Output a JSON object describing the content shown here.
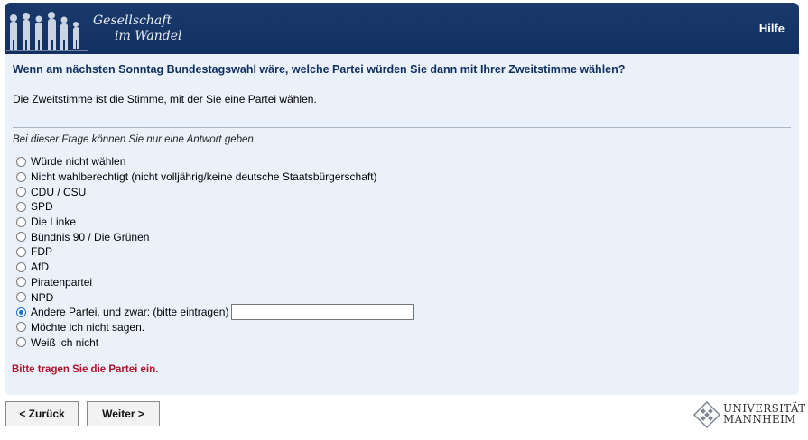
{
  "header": {
    "logo_line1": "Gesellschaft",
    "logo_line2": "im Wandel",
    "help_label": "Hilfe",
    "background_color": "#163567"
  },
  "question": {
    "title": "Wenn am nächsten Sonntag Bundestagswahl wäre, welche Partei würden Sie dann mit Ihrer Zweitstimme wählen?",
    "explanation": "Die Zweitstimme ist die Stimme, mit der Sie eine Partei wählen.",
    "instruction": "Bei dieser Frage können Sie nur eine Antwort geben."
  },
  "options": [
    {
      "label": "Würde nicht wählen",
      "selected": false
    },
    {
      "label": "Nicht wahlberechtigt (nicht volljährig/keine deutsche Staatsbürgerschaft)",
      "selected": false
    },
    {
      "label": "CDU / CSU",
      "selected": false
    },
    {
      "label": "SPD",
      "selected": false
    },
    {
      "label": "Die Linke",
      "selected": false
    },
    {
      "label": "Bündnis 90 / Die Grünen",
      "selected": false
    },
    {
      "label": "FDP",
      "selected": false
    },
    {
      "label": "AfD",
      "selected": false
    },
    {
      "label": "Piratenpartei",
      "selected": false
    },
    {
      "label": "NPD",
      "selected": false
    },
    {
      "label": "Andere Partei, und zwar: (bitte eintragen)",
      "selected": true,
      "has_text_input": true,
      "input_value": ""
    },
    {
      "label": "Möchte ich nicht sagen.",
      "selected": false
    },
    {
      "label": "Weiß ich nicht",
      "selected": false
    }
  ],
  "error_message": "Bitte tragen Sie die Partei ein.",
  "navigation": {
    "back_label": "< Zurück",
    "next_label": "Weiter >"
  },
  "footer": {
    "university_line1": "UNIVERSITÄT",
    "university_line2": "MANNHEIM"
  },
  "colors": {
    "panel": "#eaf1fb",
    "question_text": "#102e5e",
    "error": "#b0122a",
    "radio_selected": "#1a6fd1"
  }
}
